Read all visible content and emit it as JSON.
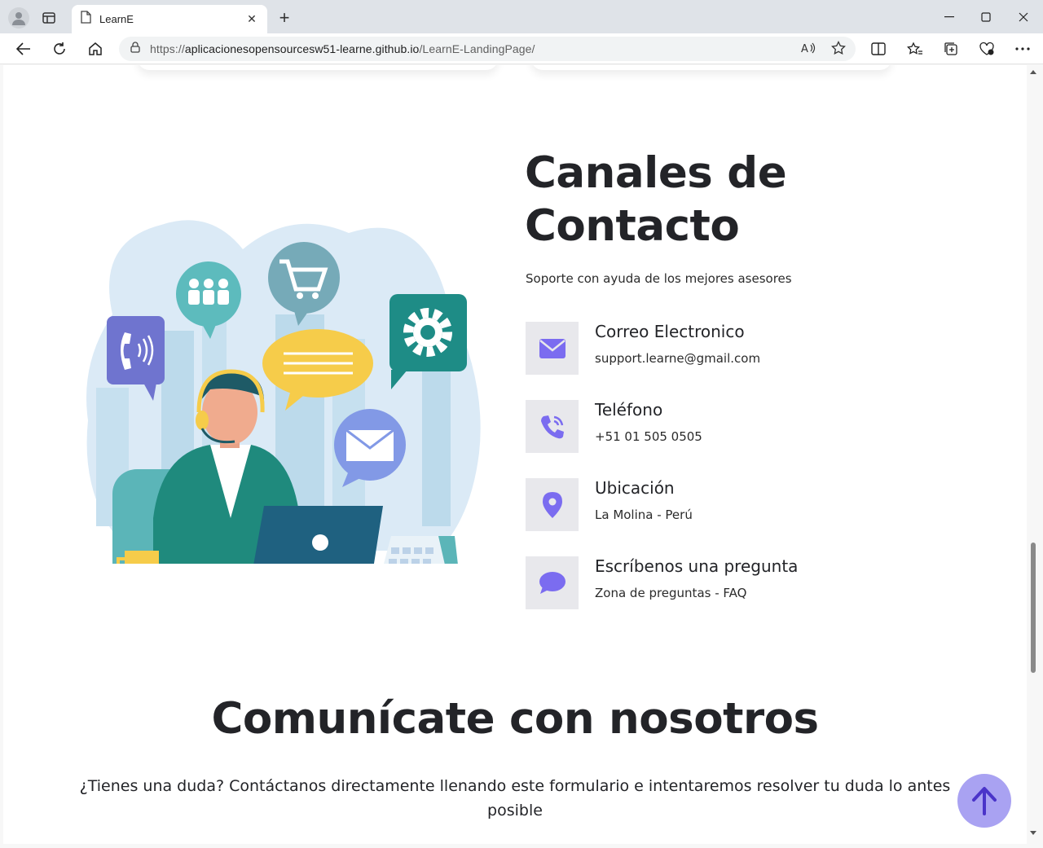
{
  "browser": {
    "tab_title": "LearnE",
    "url_prefix": "https://",
    "url_host": "aplicacionesopensourcesw51-learne.github.io",
    "url_path": "/LearnE-LandingPage/"
  },
  "contact": {
    "title": "Canales de Contacto",
    "subtitle": "Soporte con ayuda de los mejores asesores",
    "items": [
      {
        "label": "Correo Electronico",
        "value": "support.learne@gmail.com",
        "icon": "envelope-icon"
      },
      {
        "label": "Teléfono",
        "value": "+51 01 505 0505",
        "icon": "phone-icon"
      },
      {
        "label": "Ubicación",
        "value": "La Molina - Perú",
        "icon": "location-pin-icon"
      },
      {
        "label": "Escríbenos una pregunta",
        "value": "Zona de preguntas - FAQ",
        "icon": "chat-bubble-icon"
      }
    ]
  },
  "communicate": {
    "title": "Comunícate con nosotros",
    "text": "¿Tienes una duda? Contáctanos directamente llenando este formulario e intentaremos resolver tu duda lo antes posible"
  },
  "colors": {
    "accent": "#7b6cf0",
    "icon_bg": "#e8e8ec",
    "to_top_bg": "#a9a2f2",
    "heading": "#232428"
  }
}
